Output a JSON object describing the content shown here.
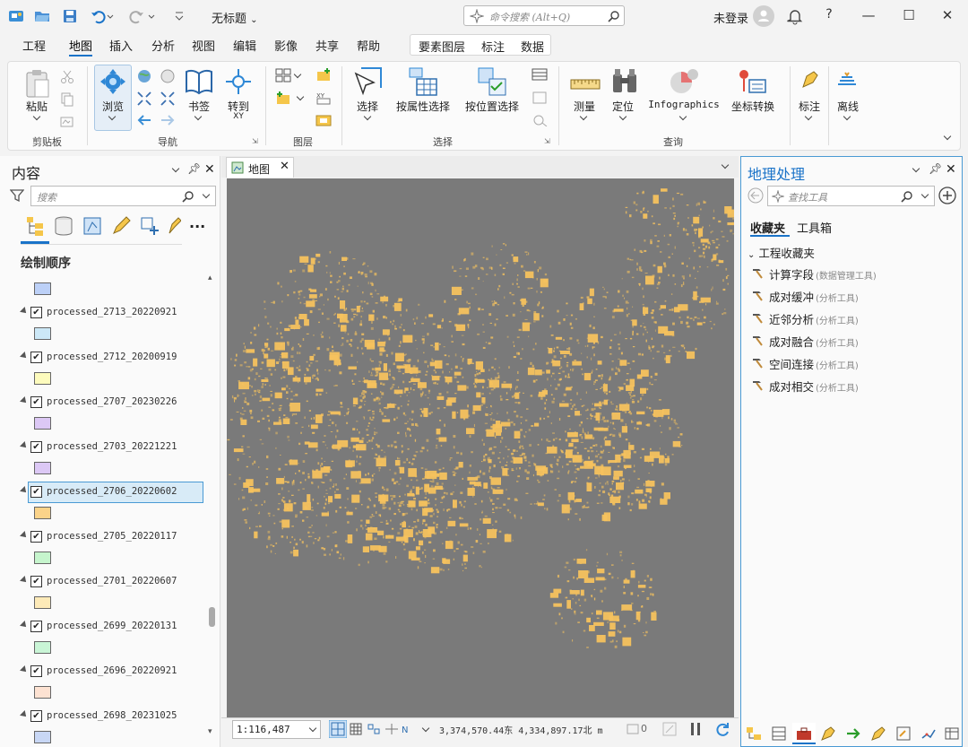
{
  "title_bar": {
    "document_title": "无标题",
    "command_search_placeholder": "命令搜索 (Alt+Q)",
    "login_label": "未登录",
    "help_label": "?"
  },
  "menu": {
    "tabs": [
      "工程",
      "地图",
      "插入",
      "分析",
      "视图",
      "编辑",
      "影像",
      "共享",
      "帮助"
    ],
    "active_tab": "地图",
    "context_tabs": [
      "要素图层",
      "标注",
      "数据"
    ]
  },
  "ribbon": {
    "paste": "粘贴",
    "clipboard_group": "剪贴板",
    "explore": "浏览",
    "bookmarks": "书签",
    "goto_xy": "转到",
    "goto_xy_sub": "XY",
    "navigate_group": "导航",
    "layer_group": "图层",
    "select": "选择",
    "select_by_attr": "按属性选择",
    "select_by_loc": "按位置选择",
    "selection_group": "选择",
    "measure": "测量",
    "locate": "定位",
    "infographics": "Infographics",
    "coord_convert": "坐标转换",
    "inquiry_group": "查询",
    "labeling": "标注",
    "offline": "离线"
  },
  "contents_pane": {
    "title": "内容",
    "search_placeholder": "搜索",
    "section_title": "绘制顺序",
    "layers": [
      {
        "name": "processed_2713_20220921",
        "color": "#cce8f7",
        "checked": true
      },
      {
        "name": "processed_2712_20200919",
        "color": "#fdfbbd",
        "checked": true
      },
      {
        "name": "processed_2707_20230226",
        "color": "#dcc8f5",
        "checked": true
      },
      {
        "name": "processed_2703_20221221",
        "color": "#dcc8f5",
        "checked": true
      },
      {
        "name": "processed_2706_20220602",
        "color": "#fbd389",
        "checked": true,
        "selected": true
      },
      {
        "name": "processed_2705_20220117",
        "color": "#c6f5cd",
        "checked": true
      },
      {
        "name": "processed_2701_20220607",
        "color": "#fdeab8",
        "checked": true
      },
      {
        "name": "processed_2699_20220131",
        "color": "#c9f5d6",
        "checked": true
      },
      {
        "name": "processed_2696_20220921",
        "color": "#fde2d2",
        "checked": true
      },
      {
        "name": "processed_2698_20231025",
        "color": "#c8d7f5",
        "checked": true
      }
    ],
    "top_swatch_color": "#bcd0f7"
  },
  "map_view": {
    "tab_label": "地图",
    "scale": "1:116,487",
    "coordinates": "3,374,570.44东 4,334,897.17北 m",
    "selected_count": "0",
    "background_color": "#7a7a7a",
    "feature_color": "#f5c25e"
  },
  "geoprocessing_pane": {
    "title": "地理处理",
    "search_placeholder": "查找工具",
    "tabs": [
      "收藏夹",
      "工具箱"
    ],
    "active_tab": "收藏夹",
    "group_label": "工程收藏夹",
    "tools": [
      {
        "name": "计算字段",
        "category": "(数据管理工具)"
      },
      {
        "name": "成对缓冲",
        "category": "(分析工具)"
      },
      {
        "name": "近邻分析",
        "category": "(分析工具)"
      },
      {
        "name": "成对融合",
        "category": "(分析工具)"
      },
      {
        "name": "空间连接",
        "category": "(分析工具)"
      },
      {
        "name": "成对相交",
        "category": "(分析工具)"
      }
    ]
  }
}
